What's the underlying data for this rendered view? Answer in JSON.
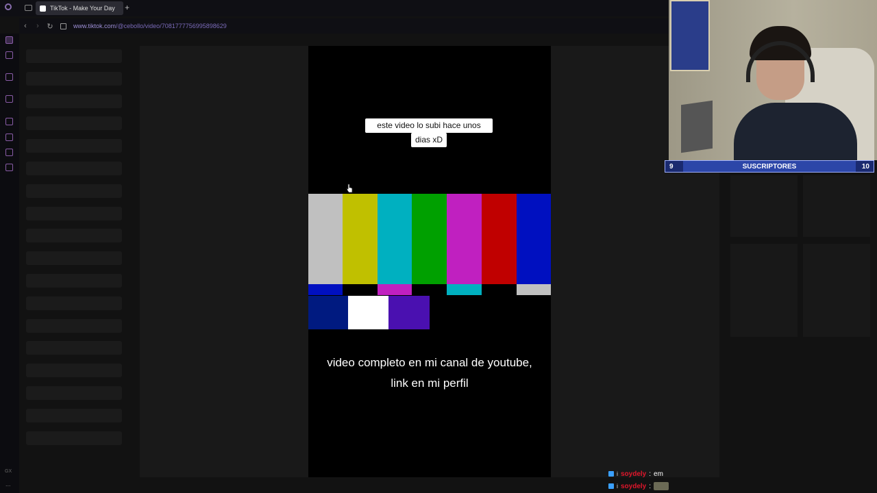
{
  "browser": {
    "tab_title": "TikTok - Make Your Day",
    "new_tab_label": "+",
    "url_host": "www.tiktok.com",
    "url_path": "/@cebollo/video/7081777756995898629"
  },
  "video": {
    "caption_top_line1": "este video lo subi hace unos",
    "caption_top_line2": "dias xD",
    "caption_bottom": "video completo en mi canal de youtube, link en mi perfil",
    "bar_colors": [
      "#c0c0c0",
      "#c0c000",
      "#00b0c0",
      "#00a000",
      "#c020c0",
      "#c00000",
      "#0010c0"
    ],
    "sub_colors": [
      "#0010c0",
      "#000000",
      "#c020c0",
      "#000000",
      "#00b0c0",
      "#000000",
      "#c0c0c0"
    ],
    "low_colors": [
      "#001a80",
      "#ffffff",
      "#4a10b0",
      "#000000"
    ]
  },
  "overlay": {
    "sub_start": "9",
    "sub_label": "SUSCRIPTORES",
    "sub_end": "10",
    "chat": [
      {
        "user": "soydely",
        "message": "em"
      },
      {
        "user": "soydely",
        "message": ""
      }
    ]
  },
  "sidebar": {
    "gx_label": "GX",
    "more_label": "..."
  }
}
